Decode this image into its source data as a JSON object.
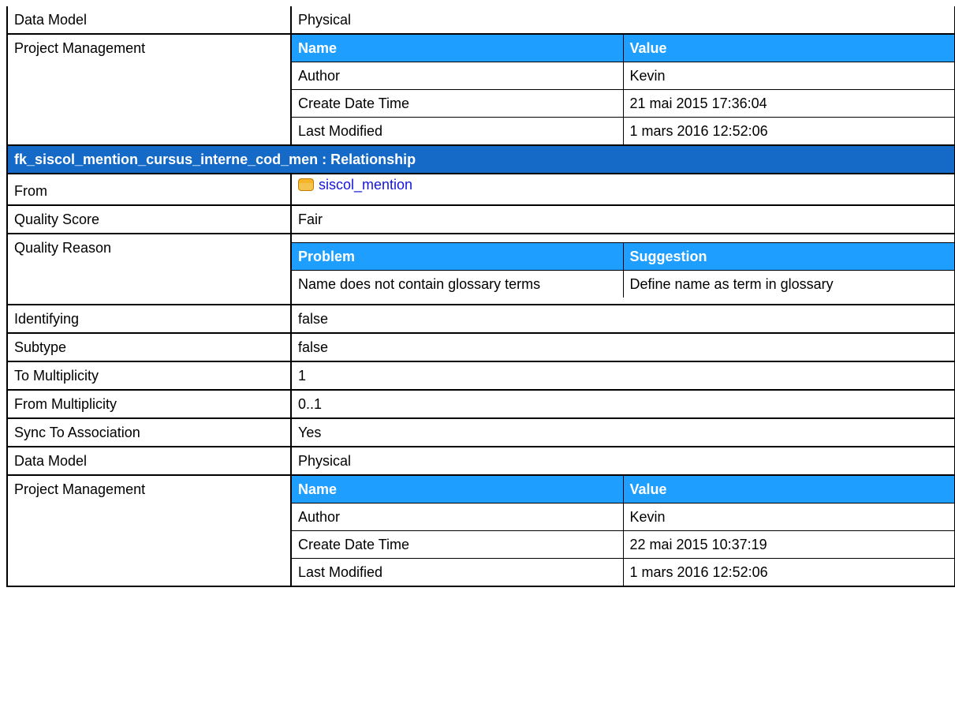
{
  "top": {
    "data_model_label": "Data Model",
    "data_model_value": "Physical",
    "pm_label": "Project Management",
    "pm_headers": [
      "Name",
      "Value"
    ],
    "pm_rows": [
      [
        "Author",
        "Kevin"
      ],
      [
        "Create Date Time",
        "21 mai 2015 17:36:04"
      ],
      [
        "Last Modified",
        "1 mars 2016 12:52:06"
      ]
    ]
  },
  "section": {
    "title": "fk_siscol_mention_cursus_interne_cod_men : Relationship",
    "from_label": "From",
    "from_value": "siscol_mention",
    "from_icon": "table-icon",
    "quality_score_label": "Quality Score",
    "quality_score_value": "Fair",
    "quality_reason_label": "Quality Reason",
    "quality_headers": [
      "Problem",
      "Suggestion"
    ],
    "quality_rows": [
      [
        "Name does not contain glossary terms",
        "Define name as term in glossary"
      ]
    ],
    "identifying_label": "Identifying",
    "identifying_value": "false",
    "subtype_label": "Subtype",
    "subtype_value": "false",
    "to_mult_label": "To Multiplicity",
    "to_mult_value": "1",
    "from_mult_label": "From Multiplicity",
    "from_mult_value": "0..1",
    "sync_label": "Sync To Association",
    "sync_value": "Yes",
    "data_model_label": "Data Model",
    "data_model_value": "Physical",
    "pm_label": "Project Management",
    "pm_headers": [
      "Name",
      "Value"
    ],
    "pm_rows": [
      [
        "Author",
        "Kevin"
      ],
      [
        "Create Date Time",
        "22 mai 2015 10:37:19"
      ],
      [
        "Last Modified",
        "1 mars 2016 12:52:06"
      ]
    ]
  },
  "colors": {
    "section_header_bg": "#1569c7",
    "subheader_bg": "#1e9fff",
    "link": "#1515d9"
  }
}
